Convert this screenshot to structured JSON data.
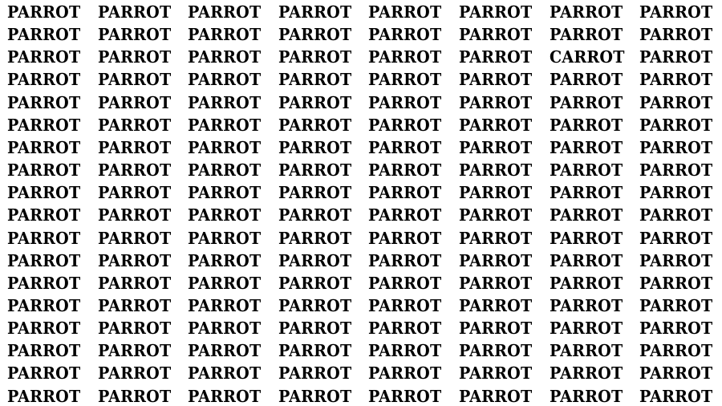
{
  "puzzle": {
    "type": "find-the-odd-word",
    "rows": 18,
    "columns": 8,
    "text_color": "#000000",
    "background_color": "#ffffff",
    "grid": [
      [
        "PARROT",
        "PARROT",
        "PARROT",
        "PARROT",
        "PARROT",
        "PARROT",
        "PARROT",
        "PARROT"
      ],
      [
        "PARROT",
        "PARROT",
        "PARROT",
        "PARROT",
        "PARROT",
        "PARROT",
        "PARROT",
        "PARROT"
      ],
      [
        "PARROT",
        "PARROT",
        "PARROT",
        "PARROT",
        "PARROT",
        "PARROT",
        "CARROT",
        "PARROT"
      ],
      [
        "PARROT",
        "PARROT",
        "PARROT",
        "PARROT",
        "PARROT",
        "PARROT",
        "PARROT",
        "PARROT"
      ],
      [
        "PARROT",
        "PARROT",
        "PARROT",
        "PARROT",
        "PARROT",
        "PARROT",
        "PARROT",
        "PARROT"
      ],
      [
        "PARROT",
        "PARROT",
        "PARROT",
        "PARROT",
        "PARROT",
        "PARROT",
        "PARROT",
        "PARROT"
      ],
      [
        "PARROT",
        "PARROT",
        "PARROT",
        "PARROT",
        "PARROT",
        "PARROT",
        "PARROT",
        "PARROT"
      ],
      [
        "PARROT",
        "PARROT",
        "PARROT",
        "PARROT",
        "PARROT",
        "PARROT",
        "PARROT",
        "PARROT"
      ],
      [
        "PARROT",
        "PARROT",
        "PARROT",
        "PARROT",
        "PARROT",
        "PARROT",
        "PARROT",
        "PARROT"
      ],
      [
        "PARROT",
        "PARROT",
        "PARROT",
        "PARROT",
        "PARROT",
        "PARROT",
        "PARROT",
        "PARROT"
      ],
      [
        "PARROT",
        "PARROT",
        "PARROT",
        "PARROT",
        "PARROT",
        "PARROT",
        "PARROT",
        "PARROT"
      ],
      [
        "PARROT",
        "PARROT",
        "PARROT",
        "PARROT",
        "PARROT",
        "PARROT",
        "PARROT",
        "PARROT"
      ],
      [
        "PARROT",
        "PARROT",
        "PARROT",
        "PARROT",
        "PARROT",
        "PARROT",
        "PARROT",
        "PARROT"
      ],
      [
        "PARROT",
        "PARROT",
        "PARROT",
        "PARROT",
        "PARROT",
        "PARROT",
        "PARROT",
        "PARROT"
      ],
      [
        "PARROT",
        "PARROT",
        "PARROT",
        "PARROT",
        "PARROT",
        "PARROT",
        "PARROT",
        "PARROT"
      ],
      [
        "PARROT",
        "PARROT",
        "PARROT",
        "PARROT",
        "PARROT",
        "PARROT",
        "PARROT",
        "PARROT"
      ],
      [
        "PARROT",
        "PARROT",
        "PARROT",
        "PARROT",
        "PARROT",
        "PARROT",
        "PARROT",
        "PARROT"
      ],
      [
        "PARROT",
        "PARROT",
        "PARROT",
        "PARROT",
        "PARROT",
        "PARROT",
        "PARROT",
        "PARROT"
      ]
    ]
  }
}
